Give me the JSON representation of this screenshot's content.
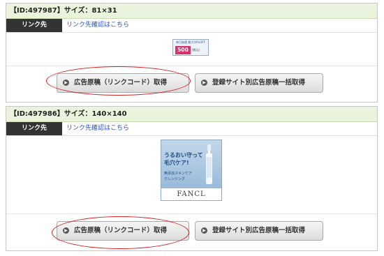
{
  "cards": [
    {
      "header": "【ID:497987】サイズ：81×31",
      "link_label": "リンク先",
      "link_value": "リンク先確認はこちら",
      "banner": {
        "top_text": "毎日抽選 最大50%OFF",
        "price": "500円",
        "note": "(税込)"
      },
      "buttons": {
        "get_code": "広告原稿（リンクコード）取得",
        "bulk_get": "登録サイト別広告原稿一括取得"
      }
    },
    {
      "header": "【ID:497986】サイズ：140×140",
      "link_label": "リンク先",
      "link_value": "リンク先確認はこちら",
      "banner": {
        "line1": "うるおい守って",
        "line2": "毛穴ケア!",
        "line3": "無添加スキンケア",
        "line4": "クレンジング",
        "logo": "FANCL"
      },
      "buttons": {
        "get_code": "広告原稿（リンクコード）取得",
        "bulk_get": "登録サイト別広告原稿一括取得"
      }
    }
  ],
  "colors": {
    "header_bg": "#eaf4dc",
    "link_label_bg": "#333333",
    "link_text": "#2a55c9",
    "annotation_red": "#d62020"
  }
}
